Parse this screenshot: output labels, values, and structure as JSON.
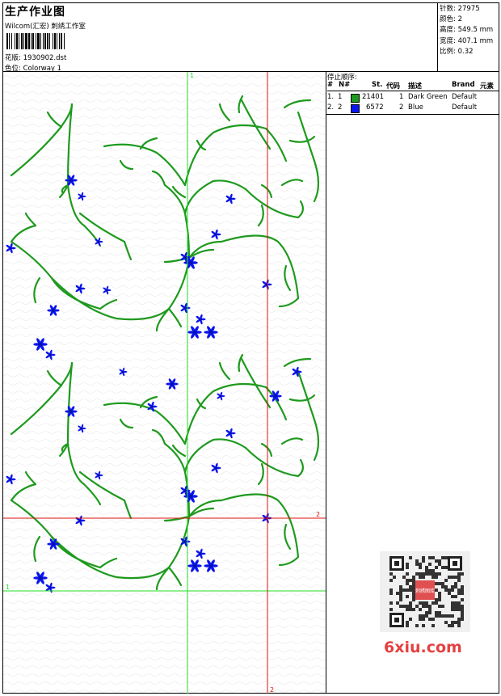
{
  "header": {
    "title": "生产作业图",
    "company": "Wilcom(汇宏) 刺绣工作室",
    "file_label": "花版:",
    "file_name": "1930902.dst",
    "colorway_label": "色位:",
    "colorway_name": "Colorway 1"
  },
  "stats": [
    {
      "label": "针数:",
      "value": "27975"
    },
    {
      "label": "颜色:",
      "value": "2"
    },
    {
      "label": "高度:",
      "value": "549.5 mm"
    },
    {
      "label": "宽度:",
      "value": "407.1 mm"
    },
    {
      "label": "比例:",
      "value": "0.32"
    }
  ],
  "stop_sequence": {
    "label": "停止顺序:",
    "columns": [
      "#",
      "N#",
      "St.",
      "代码",
      "描述",
      "Brand",
      "元素"
    ],
    "rows": [
      {
        "index": "1.",
        "needle": "1",
        "color": "#1e9a1e",
        "stitches": "21401",
        "code": "1",
        "description": "Dark Green",
        "brand": "Default"
      },
      {
        "index": "2.",
        "needle": "2",
        "color": "#0a14ee",
        "stitches": "6572",
        "code": "2",
        "description": "Blue",
        "brand": "Default"
      }
    ]
  },
  "design": {
    "guide_labels": {
      "green_v": "1",
      "green_h": "1",
      "red_v": "2",
      "red_h": "2"
    },
    "colors": {
      "stem": "#1e9a1e",
      "flower": "#0a14ee",
      "guide_green": "#22dd22",
      "guide_red": "#dd1111"
    }
  },
  "watermark": {
    "text": "6xiu.com",
    "qr_caption": "刺绣图库"
  }
}
